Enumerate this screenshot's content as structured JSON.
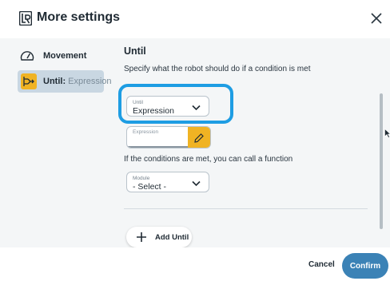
{
  "window": {
    "title": "More settings",
    "logo_icon": "ur-logo-icon",
    "close_icon": "close-icon"
  },
  "sidebar": {
    "items": [
      {
        "icon": "speedometer-icon",
        "label": "Movement",
        "secondary": ""
      },
      {
        "icon": "until-node-icon",
        "label": "Until:",
        "secondary": "Expression",
        "active": true
      }
    ]
  },
  "main": {
    "title": "Until",
    "description": "Specify what the robot should do if a condition is met",
    "until_select": {
      "label": "Until",
      "value": "Expression"
    },
    "expression_field": {
      "placeholder": "Expression",
      "value": ""
    },
    "condition_text": "If the conditions are met, you can call a function",
    "module_select": {
      "label": "Module",
      "value": "- Select -"
    },
    "add_button": "Add Until"
  },
  "footer": {
    "cancel_label": "Cancel",
    "confirm_label": "Confirm"
  },
  "colors": {
    "accent": "#3b82b6",
    "highlight": "#1e9de3",
    "edit_button": "#f0b323",
    "active_item": "#c9d7e2",
    "panel_bg": "#f4f6f7"
  }
}
